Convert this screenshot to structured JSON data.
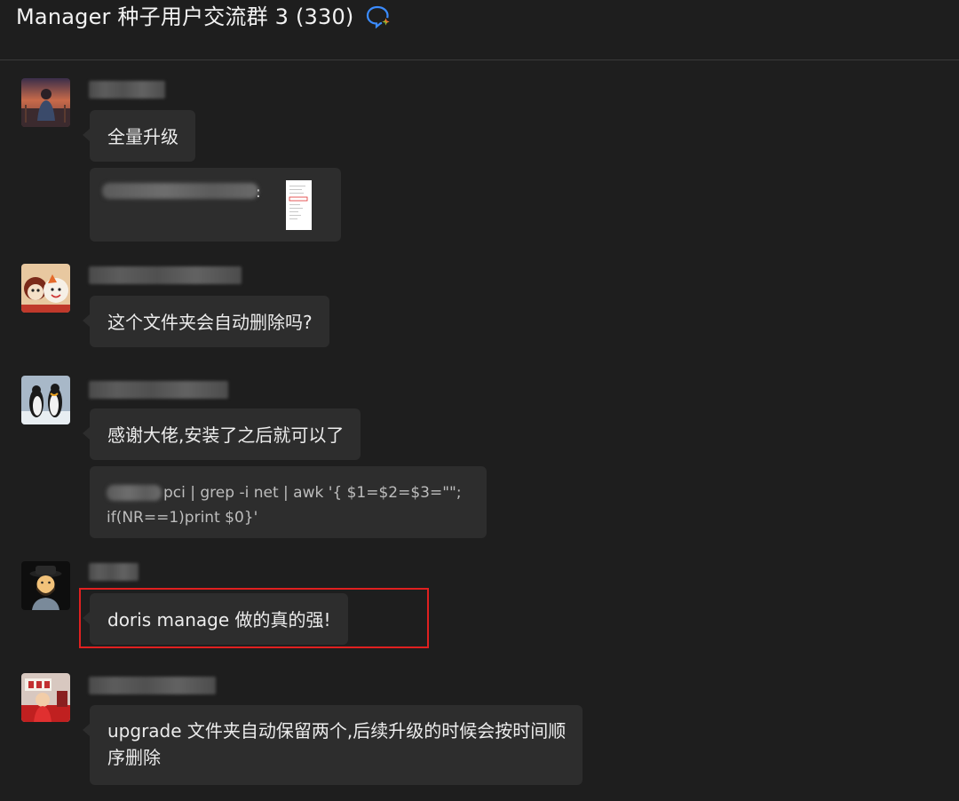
{
  "header": {
    "title": "Manager 种子用户交流群 3 (330)",
    "icon": "group-chat-icon"
  },
  "messages": [
    {
      "avatar_icon": "avatar-sunset-person",
      "text": "全量升级",
      "quote_suffix": ":"
    },
    {
      "avatar_icon": "avatar-cartoon-characters",
      "text": "这个文件夹会自动删除吗?"
    },
    {
      "avatar_icon": "avatar-penguins",
      "text": "感谢大佬,安装了之后就可以了",
      "code_line1": "pci | grep -i net | awk '{ $1=$2=$3=\"\";",
      "code_line2": "if(NR==1)print $0}'"
    },
    {
      "avatar_icon": "avatar-emoji-man",
      "text": "doris manage 做的真的强!"
    },
    {
      "avatar_icon": "avatar-child-photo",
      "text_line1": "upgrade 文件夹自动保留两个,后续升级的时候会按时间顺",
      "text_line2": "序删除"
    }
  ],
  "colors": {
    "background": "#1e1e1e",
    "bubble": "#2d2d2d",
    "highlight": "#e02020"
  }
}
